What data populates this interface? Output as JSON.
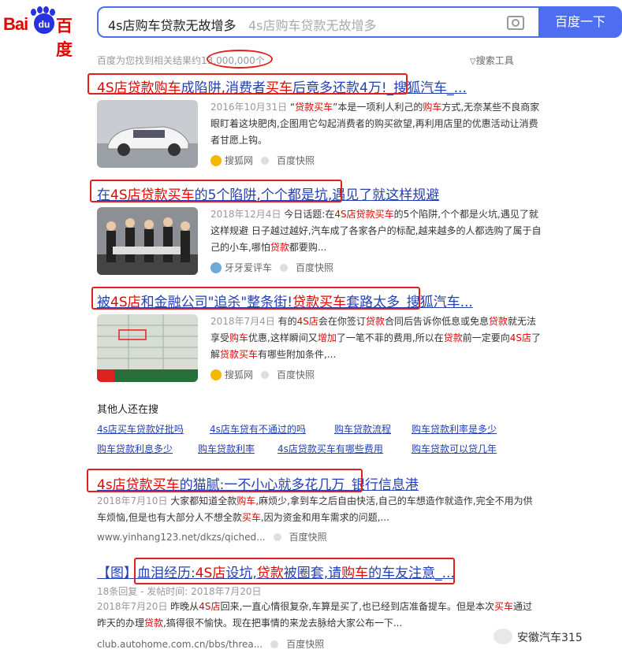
{
  "logo": {
    "bai": "Bai",
    "du": "du",
    "cn": "百度"
  },
  "search": {
    "query": "4s店购车贷款无故增多",
    "ghost": "4s店购车贷款无故增多",
    "button": "百度一下"
  },
  "result_count": "百度为您找到相关结果约13,000,000个",
  "search_tools": "搜索工具",
  "results": [
    {
      "title_parts": [
        [
          "4S店贷款购车",
          "r"
        ],
        [
          "成陷阱,消费者",
          "b"
        ],
        [
          "买车",
          "r"
        ],
        [
          "后竟多还款4万!_搜狐汽车_...",
          "b"
        ]
      ],
      "date": "2016年10月31日",
      "snippet_parts": [
        [
          "“",
          "n"
        ],
        [
          "贷款买车",
          "r"
        ],
        [
          "”本是一项利人利己的",
          "n"
        ],
        [
          "购车",
          "r"
        ],
        [
          "方式,无奈某些不良商家眼盯着这块肥肉,企图用它勾起消费者的购买欲望,再利用店里的优惠活动让消费者甘愿上钩。",
          "n"
        ]
      ],
      "source": "搜狐网",
      "snapshot": "百度快照"
    },
    {
      "title_parts": [
        [
          "在",
          "b"
        ],
        [
          "4S店贷款买车",
          "r"
        ],
        [
          "的5个陷阱,个个都是坑,遇见了就这样规避",
          "b"
        ]
      ],
      "date": "2018年12月4日",
      "snippet_parts": [
        [
          "今日话题:在",
          "n"
        ],
        [
          "4S店贷款买车",
          "r"
        ],
        [
          "的5个陷阱,个个都是火坑,遇见了就这样规避 日子越过越好,汽车成了各家各户的标配,越来越多的人都选购了属于自己的小车,哪怕",
          "n"
        ],
        [
          "贷款",
          "r"
        ],
        [
          "都要购...",
          "n"
        ]
      ],
      "source": "牙牙爱评车",
      "snapshot": "百度快照"
    },
    {
      "title_parts": [
        [
          "被",
          "b"
        ],
        [
          "4S店",
          "r"
        ],
        [
          "和金融公司\"追杀\"整条街!",
          "b"
        ],
        [
          "贷款买车",
          "r"
        ],
        [
          "套路太多_搜狐汽车...",
          "b"
        ]
      ],
      "date": "2018年7月4日",
      "snippet_parts": [
        [
          "有的",
          "n"
        ],
        [
          "4S店",
          "r"
        ],
        [
          "会在你签订",
          "n"
        ],
        [
          "贷款",
          "r"
        ],
        [
          "合同后告诉你低息或免息",
          "n"
        ],
        [
          "贷款",
          "r"
        ],
        [
          "就无法享受",
          "n"
        ],
        [
          "购车",
          "r"
        ],
        [
          "优惠,这样瞬间又",
          "n"
        ],
        [
          "增加",
          "r"
        ],
        [
          "了一笔不菲的费用,所以在",
          "n"
        ],
        [
          "贷款",
          "r"
        ],
        [
          "前一定要向",
          "n"
        ],
        [
          "4S店",
          "r"
        ],
        [
          "了解",
          "n"
        ],
        [
          "贷款买车",
          "r"
        ],
        [
          "有哪些附加条件,...",
          "n"
        ]
      ],
      "source": "搜狐网",
      "snapshot": "百度快照"
    }
  ],
  "related": {
    "title": "其他人还在搜",
    "rows": [
      [
        "4s店买车贷款好批吗",
        "4s店车贷有不通过的吗",
        "购车贷款流程",
        "购车贷款利率是多少"
      ],
      [
        "购车贷款利息多少",
        "购车贷款利率",
        "4s店贷款买车有哪些费用",
        "购车贷款可以贷几年"
      ]
    ]
  },
  "results2": [
    {
      "title_parts": [
        [
          "4s店贷款买车",
          "r"
        ],
        [
          "的猫腻:一不小心就多花几万_银行信息港",
          "b"
        ]
      ],
      "date": "2018年7月10日",
      "snippet_parts": [
        [
          "大家都知道全款",
          "n"
        ],
        [
          "购车",
          "r"
        ],
        [
          ",麻烦少,拿到车之后自由快活,自己的车想造作就造作,完全不用为供车烦恼,但是也有大部分人不想全款",
          "n"
        ],
        [
          "买车",
          "r"
        ],
        [
          ",因为资金和用车需求的问题,...",
          "n"
        ]
      ],
      "url": "www.yinhang123.net/dkzs/qiched...",
      "snapshot": "百度快照"
    },
    {
      "title_parts": [
        [
          "【图】血泪经历:",
          "b"
        ],
        [
          "4S店",
          "r"
        ],
        [
          "设坑,",
          "b"
        ],
        [
          "贷款",
          "r"
        ],
        [
          "被圈套,请",
          "b"
        ],
        [
          "购车",
          "r"
        ],
        [
          "的车友注意_...",
          "b"
        ]
      ],
      "meta": "18条回复 - 发帖时间: 2018年7月20日",
      "date": "2018年7月20日",
      "snippet_parts": [
        [
          "昨晚从",
          "n"
        ],
        [
          "4S店",
          "r"
        ],
        [
          "回来,一直心情很复杂,车算是买了,也已经到店准备提车。但是本次",
          "n"
        ],
        [
          "买车",
          "r"
        ],
        [
          "通过昨天的办理",
          "n"
        ],
        [
          "贷款",
          "r"
        ],
        [
          ",搞得很不愉快。现在把事情的来龙去脉给大家公布一下...",
          "n"
        ]
      ],
      "url": "club.autohome.com.cn/bbs/threa...",
      "snapshot": "百度快照"
    }
  ],
  "watermark": "安徽汽车315",
  "colors": {
    "accent": "#4e6ef2",
    "link": "#2440b3",
    "highlight": "#e10602",
    "annotation_box": "#e0211b"
  }
}
